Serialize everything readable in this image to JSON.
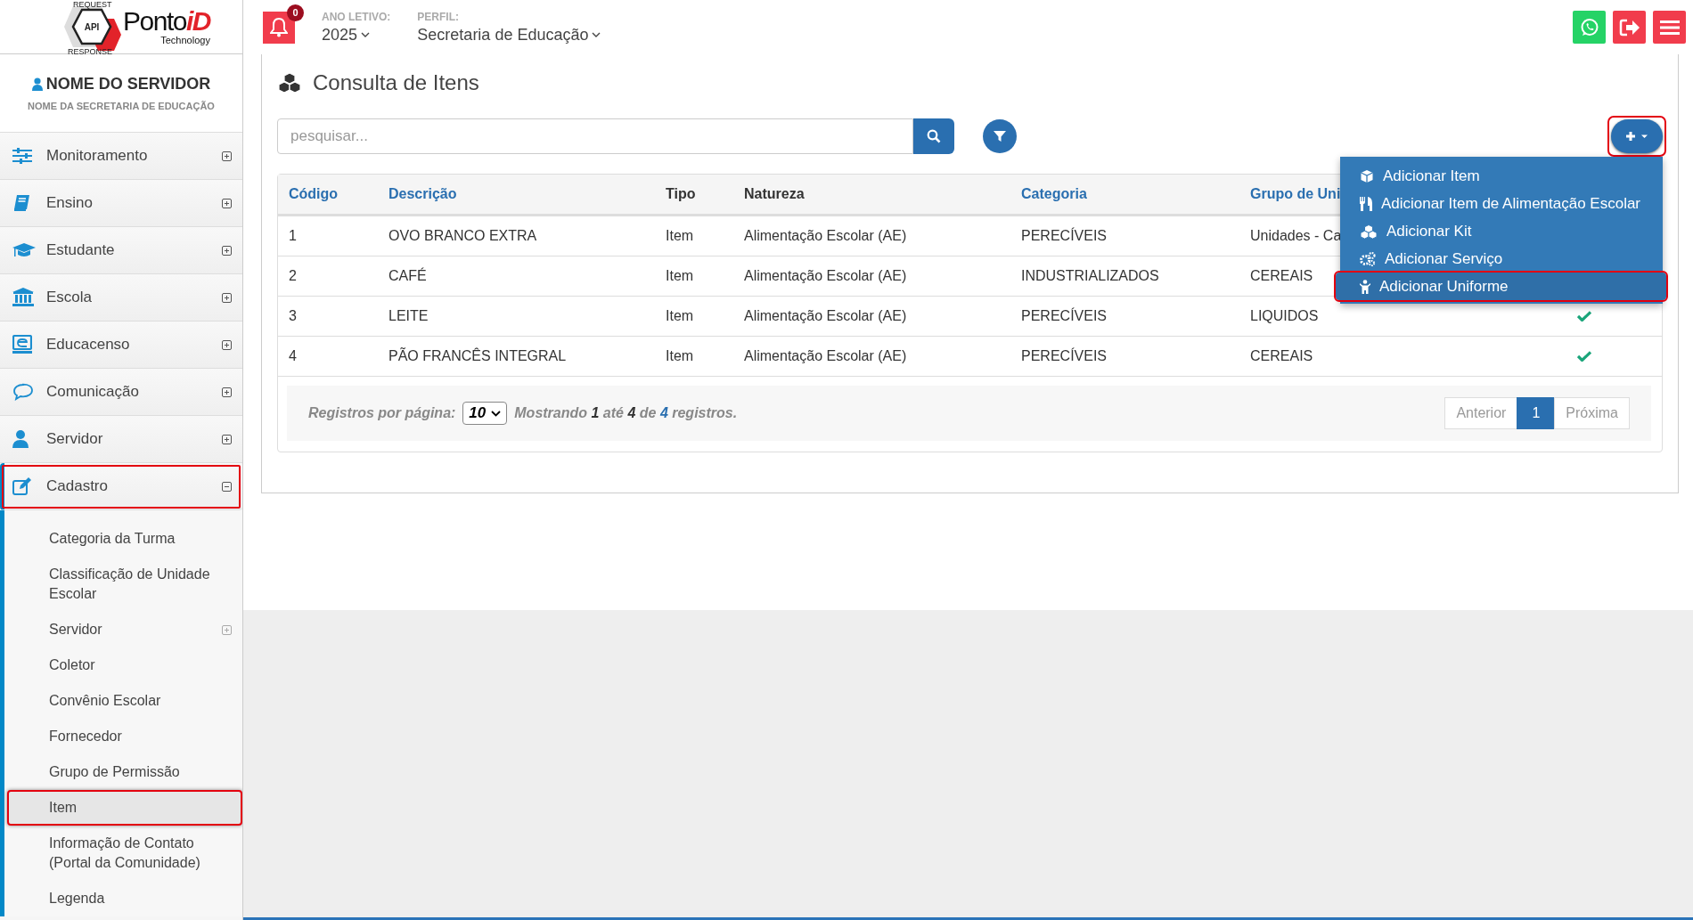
{
  "logo": {
    "badge": "API",
    "arrow_top": "REQUEST",
    "arrow_bottom": "RESPONSE",
    "brand": "Ponto",
    "brand_accent": "iD",
    "tagline": "Technology"
  },
  "header": {
    "notifications": "0",
    "year_label": "ANO LETIVO:",
    "year": "2025",
    "profile_label": "PERFIL:",
    "profile": "Secretaria de Educação",
    "buttons": [
      {
        "kind": "whatsapp"
      },
      {
        "kind": "logout"
      },
      {
        "kind": "menu"
      }
    ]
  },
  "user": {
    "name": "NOME DO SERVIDOR",
    "org": "NOME DA SECRETARIA DE EDUCAÇÃO"
  },
  "sidebar": {
    "items": [
      {
        "label": "Monitoramento",
        "expanded": false,
        "annotated": false
      },
      {
        "label": "Ensino",
        "expanded": false,
        "annotated": false
      },
      {
        "label": "Estudante",
        "expanded": false,
        "annotated": false
      },
      {
        "label": "Escola",
        "expanded": false,
        "annotated": false
      },
      {
        "label": "Educacenso",
        "expanded": false,
        "annotated": false
      },
      {
        "label": "Comunicação",
        "expanded": false,
        "annotated": false
      },
      {
        "label": "Servidor",
        "expanded": false,
        "annotated": false
      },
      {
        "label": "Cadastro",
        "expanded": true,
        "annotated": true,
        "children": [
          {
            "label": "Categoria da Turma",
            "selected": false,
            "expandable": false,
            "annotated": false
          },
          {
            "label": "Classificação de Unidade Escolar",
            "selected": false,
            "expandable": false,
            "annotated": false
          },
          {
            "label": "Servidor",
            "selected": false,
            "expandable": true,
            "annotated": false
          },
          {
            "label": "Coletor",
            "selected": false,
            "expandable": false,
            "annotated": false
          },
          {
            "label": "Convênio Escolar",
            "selected": false,
            "expandable": false,
            "annotated": false
          },
          {
            "label": "Fornecedor",
            "selected": false,
            "expandable": false,
            "annotated": false
          },
          {
            "label": "Grupo de Permissão",
            "selected": false,
            "expandable": false,
            "annotated": false
          },
          {
            "label": "Item",
            "selected": true,
            "expandable": false,
            "annotated": true
          },
          {
            "label": "Informação de Contato (Portal da Comunidade)",
            "selected": false,
            "expandable": false,
            "annotated": false
          },
          {
            "label": "Legenda",
            "selected": false,
            "expandable": false,
            "annotated": false
          }
        ]
      }
    ]
  },
  "page": {
    "title": "Consulta de Itens",
    "search": {
      "placeholder": "pesquisar..."
    },
    "add_menu": {
      "open": true,
      "annotated": true,
      "items": [
        {
          "label": "Adicionar Item",
          "selected": false,
          "annotated": false
        },
        {
          "label": "Adicionar Item de Alimentação Escolar",
          "selected": false,
          "annotated": false
        },
        {
          "label": "Adicionar Kit",
          "selected": false,
          "annotated": false
        },
        {
          "label": "Adicionar Serviço",
          "selected": false,
          "annotated": false
        },
        {
          "label": "Adicionar Uniforme",
          "selected": true,
          "annotated": true
        }
      ]
    }
  },
  "table": {
    "columns": [
      {
        "label": "Código",
        "sortable": true
      },
      {
        "label": "Descrição",
        "sortable": true
      },
      {
        "label": "Tipo",
        "sortable": false
      },
      {
        "label": "Natureza",
        "sortable": false
      },
      {
        "label": "Categoria",
        "sortable": true
      },
      {
        "label": "Grupo de Uni",
        "sortable": true
      }
    ],
    "rows": [
      {
        "cells": [
          "1",
          "OVO BRANCO EXTRA",
          "Item",
          "Alimentação Escolar (AE)",
          "PERECÍVEIS",
          "Unidades - Ca"
        ]
      },
      {
        "cells": [
          "2",
          "CAFÉ",
          "Item",
          "Alimentação Escolar (AE)",
          "INDUSTRIALIZADOS",
          "CEREAIS"
        ]
      },
      {
        "cells": [
          "3",
          "LEITE",
          "Item",
          "Alimentação Escolar (AE)",
          "PERECÍVEIS",
          "LIQUIDOS"
        ],
        "active": true
      },
      {
        "cells": [
          "4",
          "PÃO FRANCÊS INTEGRAL",
          "Item",
          "Alimentação Escolar (AE)",
          "PERECÍVEIS",
          "CEREAIS"
        ],
        "active": true
      }
    ]
  },
  "footer": {
    "per_page_label": "Registros por página:",
    "per_page": "10",
    "summary": "Mostrando **1** até **4** de **4** registros.",
    "pages": [
      {
        "label": "Anterior",
        "selected": false,
        "disabled": true
      },
      {
        "label": "1",
        "selected": true,
        "disabled": false
      },
      {
        "label": "Próxima",
        "selected": false,
        "disabled": true
      }
    ]
  }
}
